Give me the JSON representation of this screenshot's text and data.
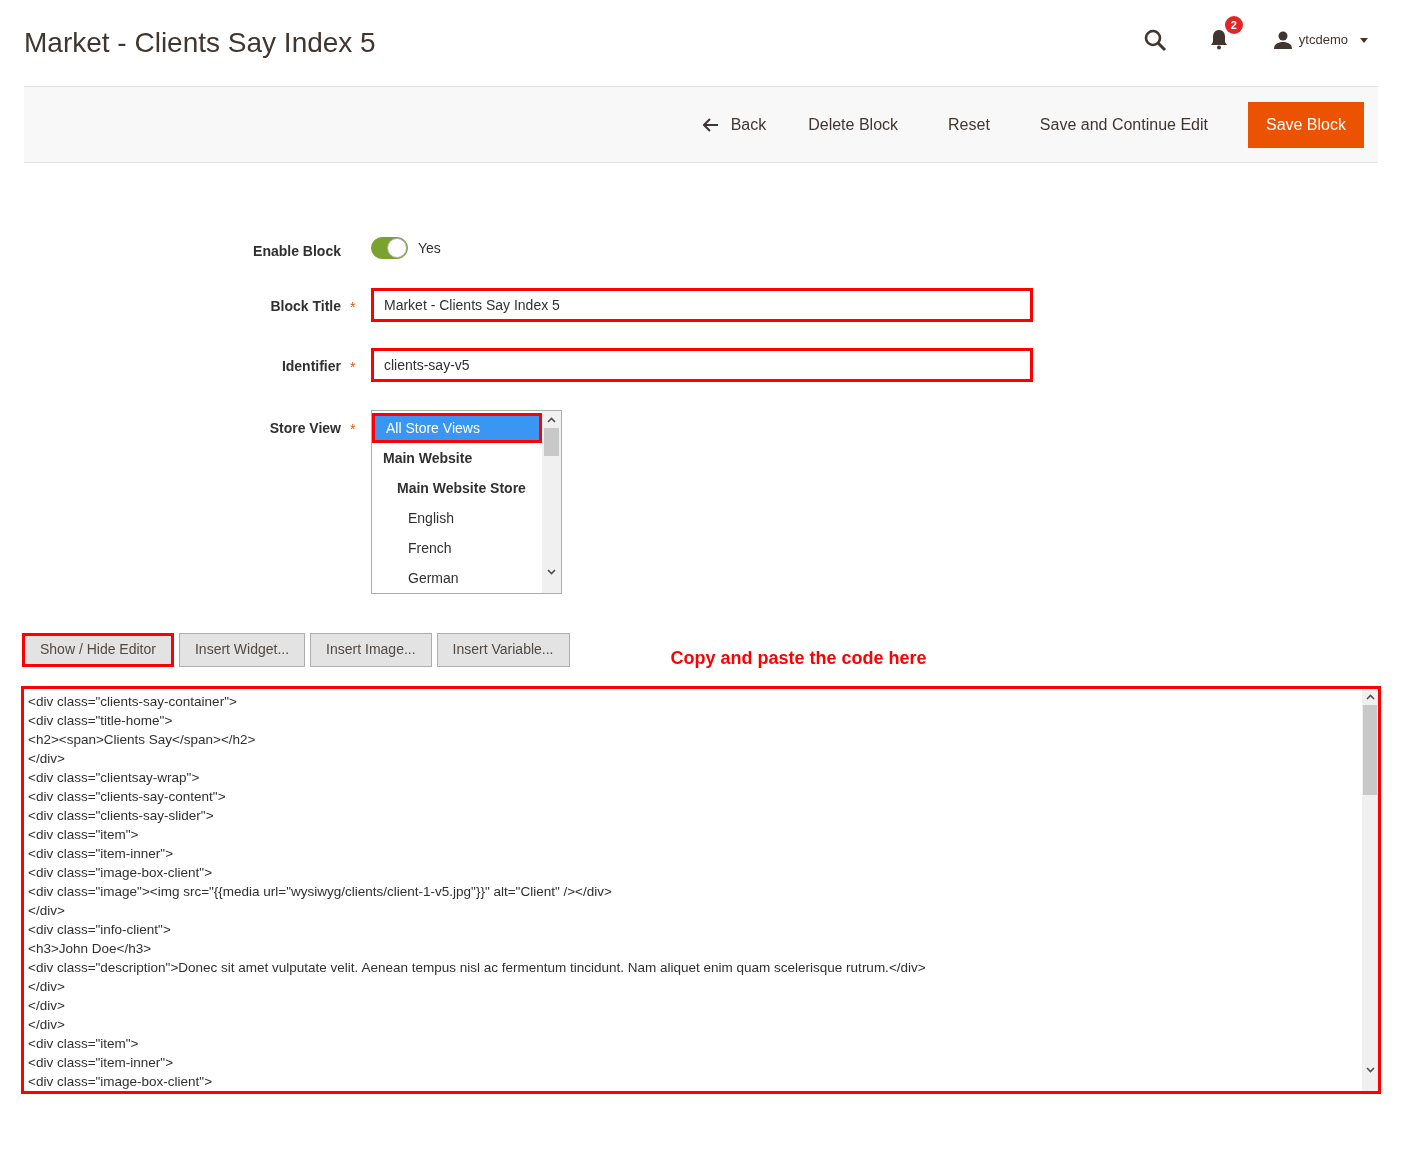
{
  "page_title": "Market - Clients Say Index 5",
  "header": {
    "notifications_count": "2",
    "user": "ytcdemo"
  },
  "actions": [
    {
      "label": "Back",
      "kind": "back"
    },
    {
      "label": "Delete Block",
      "kind": "plain"
    },
    {
      "label": "Reset",
      "kind": "plain"
    },
    {
      "label": "Save and Continue Edit",
      "kind": "plain"
    },
    {
      "label": "Save Block",
      "kind": "primary"
    }
  ],
  "form": {
    "enable_block": {
      "label": "Enable Block",
      "on": true,
      "value_label": "Yes"
    },
    "block_title": {
      "label": "Block Title",
      "required_mark": "*",
      "value": "Market - Clients Say Index 5",
      "highlighted": true
    },
    "identifier": {
      "label": "Identifier",
      "required_mark": "*",
      "value": "clients-say-v5",
      "highlighted": true
    },
    "store_view": {
      "label": "Store View",
      "required_mark": "*",
      "options": [
        {
          "label": "All Store Views",
          "selected": true,
          "highlighted": true
        },
        {
          "label": "Main Website",
          "selected": false,
          "highlighted": false,
          "children": [
            {
              "label": "Main Website Store",
              "selected": false,
              "highlighted": false,
              "children": [
                {
                  "label": "English",
                  "selected": false,
                  "highlighted": false
                },
                {
                  "label": "French",
                  "selected": false,
                  "highlighted": false
                },
                {
                  "label": "German",
                  "selected": false,
                  "highlighted": false
                }
              ]
            }
          ]
        }
      ]
    }
  },
  "editor_buttons": [
    {
      "label": "Show / Hide Editor",
      "highlighted": true
    },
    {
      "label": "Insert Widget...",
      "highlighted": false
    },
    {
      "label": "Insert Image...",
      "highlighted": false
    },
    {
      "label": "Insert Variable...",
      "highlighted": false
    }
  ],
  "annotation": "Copy and paste the code here",
  "editor": {
    "highlighted": true,
    "lines": [
      "<div class=\"clients-say-container\">",
      "<div class=\"title-home\">",
      "<h2><span>Clients Say</span></h2>",
      "</div>",
      "<div class=\"clientsay-wrap\">",
      "<div class=\"clients-say-content\">",
      "<div class=\"clients-say-slider\">",
      "<div class=\"item\">",
      "<div class=\"item-inner\">",
      "<div class=\"image-box-client\">",
      "<div class=\"image\"><img src=\"{{media url=\"wysiwyg/clients/client-1-v5.jpg\"}}\" alt=\"Client\" /></div>",
      "</div>",
      "<div class=\"info-client\">",
      "<h3>John Doe</h3>",
      "<div class=\"description\">Donec sit amet vulputate velit. Aenean tempus nisl ac fermentum tincidunt. Nam aliquet enim quam scelerisque rutrum.</div>",
      "</div>",
      "</div>",
      "</div>",
      "<div class=\"item\">",
      "<div class=\"item-inner\">",
      "<div class=\"image-box-client\">"
    ]
  }
}
